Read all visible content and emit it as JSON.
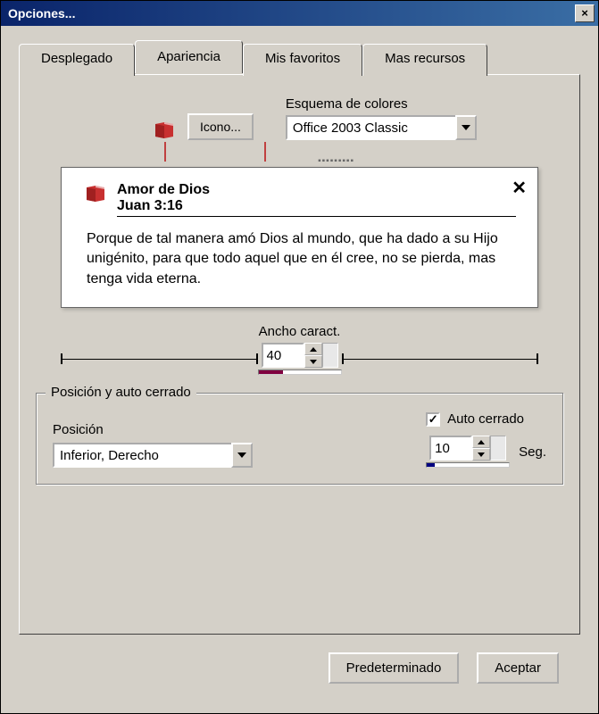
{
  "window": {
    "title": "Opciones..."
  },
  "tabs": {
    "items": [
      "Desplegado",
      "Apariencia",
      "Mis favoritos",
      "Mas recursos"
    ],
    "active": 1
  },
  "appearance": {
    "icon_button": "Icono...",
    "scheme_label": "Esquema de colores",
    "scheme_value": "Office 2003 Classic",
    "preview": {
      "title": "Amor de Dios",
      "subtitle": "Juan 3:16",
      "body": "Porque de tal manera amó Dios al mundo, que ha dado a su Hijo unigénito, para que todo aquel que en él cree, no se pierda, mas tenga vida eterna."
    },
    "width": {
      "label": "Ancho caract.",
      "value": "40",
      "progress_percent": 30
    },
    "position_group": {
      "title": "Posición y auto cerrado",
      "position_label": "Posición",
      "position_value": "Inferior, Derecho",
      "auto_close_label": "Auto cerrado",
      "auto_close_checked": true,
      "seconds_value": "10",
      "seconds_unit": "Seg.",
      "seconds_progress_percent": 10
    }
  },
  "footer": {
    "default_button": "Predeterminado",
    "accept_button": "Aceptar"
  }
}
